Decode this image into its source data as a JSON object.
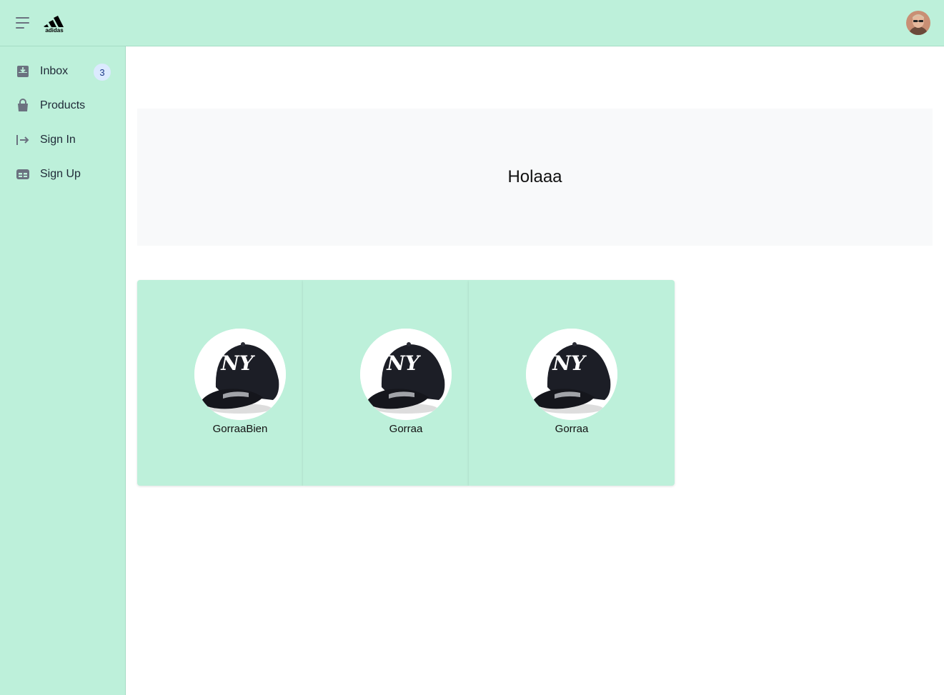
{
  "header": {
    "brand": "adidas",
    "menu_icon": "hamburger-menu-icon",
    "avatar_icon": "user-avatar"
  },
  "sidebar": {
    "items": [
      {
        "label": "Inbox",
        "icon": "inbox-download-icon",
        "badge": "3"
      },
      {
        "label": "Products",
        "icon": "shopping-bag-icon"
      },
      {
        "label": "Sign In",
        "icon": "sign-in-arrow-icon"
      },
      {
        "label": "Sign Up",
        "icon": "table-form-icon"
      }
    ]
  },
  "main": {
    "hero_title": "Holaaa",
    "products": [
      {
        "name": "GorraaBien",
        "image": "ny-yankees-cap"
      },
      {
        "name": "Gorraa",
        "image": "ny-yankees-cap"
      },
      {
        "name": "Gorraa",
        "image": "ny-yankees-cap"
      }
    ]
  },
  "colors": {
    "accent": "#bdf0da",
    "hero_bg": "#f8f9fa",
    "badge_bg": "#dbeafe"
  }
}
